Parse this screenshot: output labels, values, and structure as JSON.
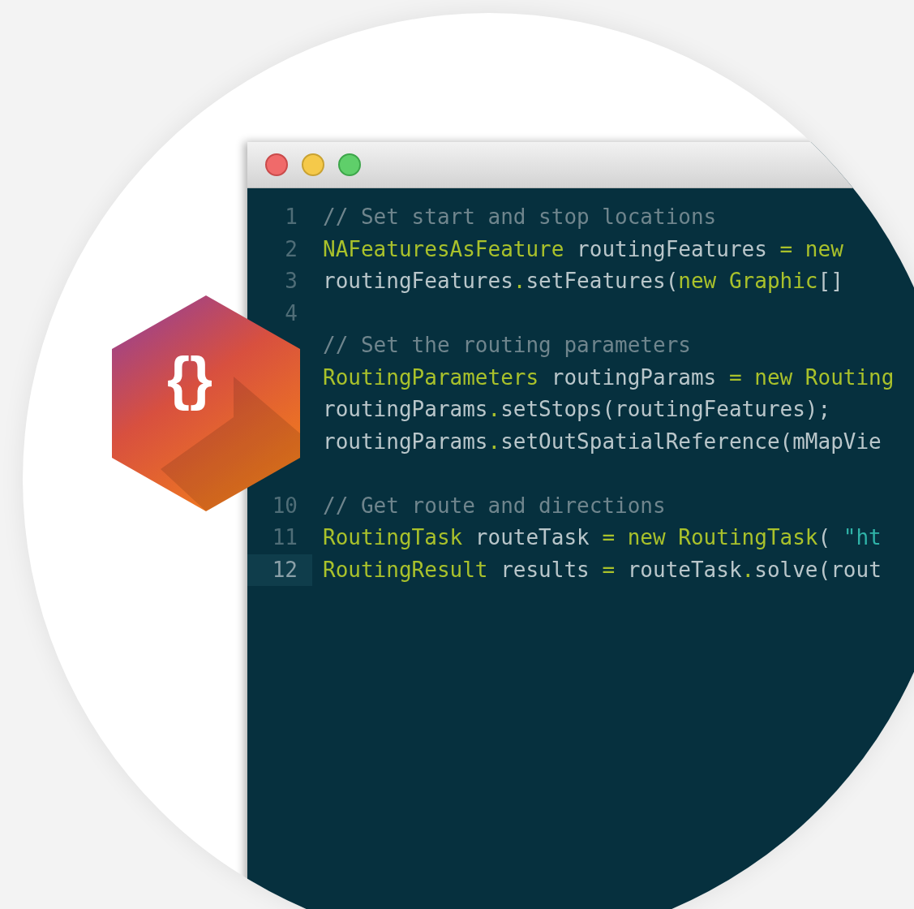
{
  "badge": {
    "text": "{}"
  },
  "window": {
    "buttons": [
      {
        "kind": "close"
      },
      {
        "kind": "minimize"
      },
      {
        "kind": "zoom"
      }
    ]
  },
  "editor": {
    "lines": [
      {
        "number": "1",
        "selected": false,
        "tokens": [
          {
            "kind": "comment",
            "text": "// Set start and stop locations"
          }
        ]
      },
      {
        "number": "2",
        "selected": false,
        "tokens": [
          {
            "kind": "type",
            "text": "NAFeaturesAsFeature"
          },
          {
            "kind": "plain",
            "text": " routingFeatures "
          },
          {
            "kind": "op",
            "text": "="
          },
          {
            "kind": "keyword",
            "text": " new"
          }
        ]
      },
      {
        "number": "3",
        "selected": false,
        "tokens": [
          {
            "kind": "plain",
            "text": "routingFeatures"
          },
          {
            "kind": "op",
            "text": "."
          },
          {
            "kind": "plain",
            "text": "setFeatures("
          },
          {
            "kind": "keyword",
            "text": "new"
          },
          {
            "kind": "type",
            "text": " Graphic"
          },
          {
            "kind": "plain",
            "text": "[]"
          }
        ]
      },
      {
        "number": "4",
        "selected": false
      },
      {
        "selected": false,
        "tokens": [
          {
            "kind": "comment",
            "text": "// Set the routing parameters"
          }
        ]
      },
      {
        "selected": false,
        "tokens": [
          {
            "kind": "type",
            "text": "RoutingParameters"
          },
          {
            "kind": "plain",
            "text": " routingParams "
          },
          {
            "kind": "op",
            "text": "="
          },
          {
            "kind": "keyword",
            "text": " new"
          },
          {
            "kind": "type",
            "text": " Routing"
          }
        ]
      },
      {
        "selected": false,
        "tokens": [
          {
            "kind": "plain",
            "text": "routingParams"
          },
          {
            "kind": "op",
            "text": "."
          },
          {
            "kind": "plain",
            "text": "setStops(routingFeatures);"
          }
        ]
      },
      {
        "selected": false,
        "tokens": [
          {
            "kind": "plain",
            "text": "routingParams"
          },
          {
            "kind": "op",
            "text": "."
          },
          {
            "kind": "plain",
            "text": "setOutSpatialReference(mMapVie"
          }
        ]
      },
      {
        "selected": false
      },
      {
        "number": "10",
        "selected": false,
        "tokens": [
          {
            "kind": "comment",
            "text": "// Get route and directions"
          }
        ]
      },
      {
        "number": "11",
        "selected": false,
        "tokens": [
          {
            "kind": "type",
            "text": "RoutingTask"
          },
          {
            "kind": "plain",
            "text": " routeTask "
          },
          {
            "kind": "op",
            "text": "="
          },
          {
            "kind": "keyword",
            "text": " new"
          },
          {
            "kind": "type",
            "text": " RoutingTask"
          },
          {
            "kind": "plain",
            "text": "( "
          },
          {
            "kind": "string",
            "text": "\"ht"
          }
        ]
      },
      {
        "number": "12",
        "selected": true,
        "tokens": [
          {
            "kind": "type",
            "text": "RoutingResult"
          },
          {
            "kind": "plain",
            "text": " results "
          },
          {
            "kind": "op",
            "text": "="
          },
          {
            "kind": "plain",
            "text": " routeTask"
          },
          {
            "kind": "op",
            "text": "."
          },
          {
            "kind": "plain",
            "text": "solve(rout"
          }
        ]
      }
    ]
  }
}
